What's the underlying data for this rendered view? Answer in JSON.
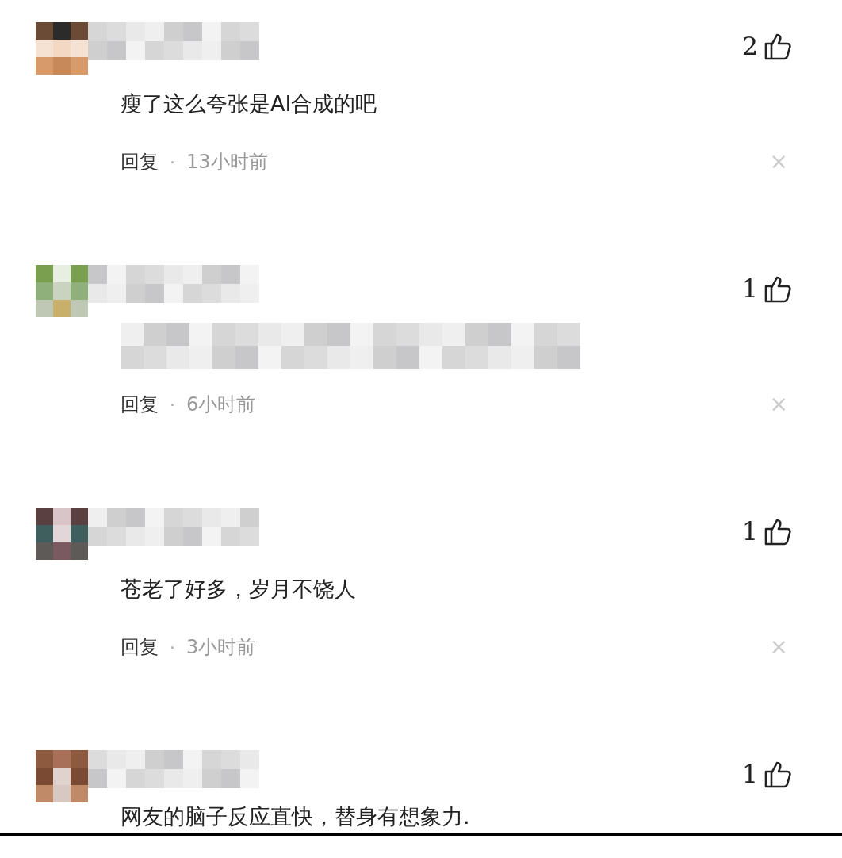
{
  "comments": [
    {
      "likes": "2",
      "text": "瘦了这么夸张是AI合成的吧",
      "reply": "回复",
      "separator": "·",
      "time": "13小时前",
      "close": "×"
    },
    {
      "likes": "1",
      "reply": "回复",
      "separator": "·",
      "time": "6小时前",
      "close": "×"
    },
    {
      "likes": "1",
      "text": "苍老了好多，岁月不饶人",
      "reply": "回复",
      "separator": "·",
      "time": "3小时前",
      "close": "×"
    },
    {
      "likes": "1",
      "text": "网友的脑子反应直快，替身有想象力."
    }
  ]
}
